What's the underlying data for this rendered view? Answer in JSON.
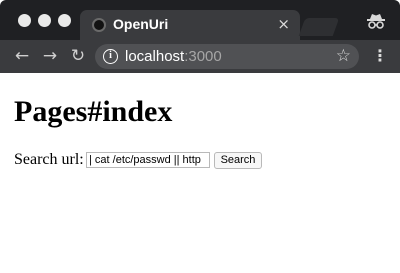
{
  "browser": {
    "tab": {
      "title": "OpenUri",
      "close_label": "×"
    },
    "address_bar": {
      "host": "localhost",
      "port": ":3000"
    },
    "icons": {
      "back": "back-arrow-icon",
      "forward": "forward-arrow-icon",
      "reload": "reload-icon",
      "info": "info-icon",
      "star": "star-icon",
      "menu": "menu-icon",
      "incognito": "incognito-icon"
    },
    "colors": {
      "titlebar": "#1f2023",
      "toolbar": "#3a3b3e",
      "omnibox": "#505154"
    }
  },
  "page": {
    "title": "Pages#index",
    "search": {
      "label": "Search url:",
      "value": "| cat /etc/passwd || http",
      "button_label": "Search"
    }
  }
}
